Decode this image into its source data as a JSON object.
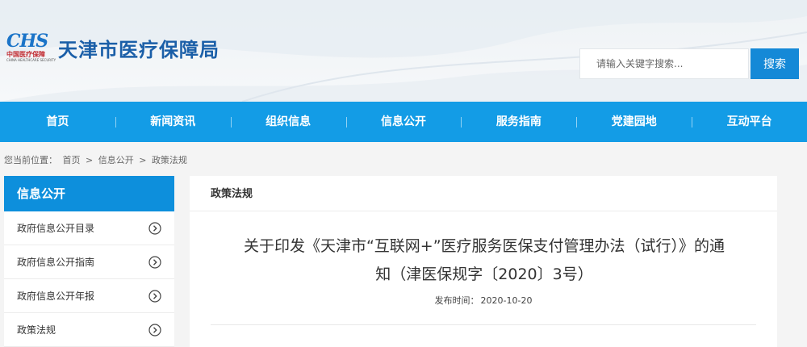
{
  "header": {
    "logo_text": "CHS",
    "logo_cn": "中国医疗保障",
    "logo_en": "CHINA HEALTHCARE SECURITY",
    "site_title": "天津市医疗保障局",
    "search_placeholder": "请输入关键字搜索...",
    "search_button": "搜索"
  },
  "nav": {
    "items": [
      "首页",
      "新闻资讯",
      "组织信息",
      "信息公开",
      "服务指南",
      "党建园地",
      "互动平台"
    ]
  },
  "breadcrumb": {
    "label": "您当前位置：",
    "items": [
      "首页",
      "信息公开",
      "政策法规"
    ],
    "separator": ">"
  },
  "sidebar": {
    "title": "信息公开",
    "items": [
      "政府信息公开目录",
      "政府信息公开指南",
      "政府信息公开年报",
      "政策法规"
    ]
  },
  "main": {
    "section_title": "政策法规",
    "article_title_line1": "关于印发《天津市“互联网+”医疗服务医保支付管理办法（试行）》的通",
    "article_title_line2": "知（津医保规字〔2020〕3号）",
    "date_label": "发布时间：",
    "date_value": "2020-10-20"
  },
  "colors": {
    "brand_blue": "#139ce6",
    "sidebar_blue": "#0d8fdc",
    "title_blue": "#1b5fa8",
    "logo_red": "#c0282e"
  }
}
